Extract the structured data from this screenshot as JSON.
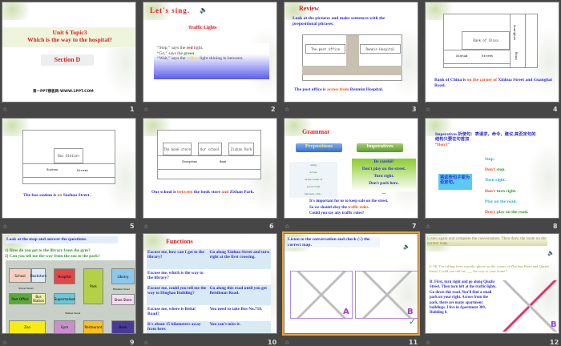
{
  "slides": [
    {
      "number": "1",
      "title1": "Unit 6 Topic3",
      "title2": "Which is the way to the hospital?",
      "section": "Section D",
      "footer": "第一PPT模板网-WWW.1PPT.COM"
    },
    {
      "number": "2",
      "heading": "Let's sing.",
      "song": "Traffic Lights",
      "l1a": "“Stop,” says the ",
      "l1b": "red",
      "l1c": " light.",
      "l2a": "“Go,” says the ",
      "l2b": "green",
      "l2c": ".",
      "l3a": "“Wait,” says the ",
      "l3b": "yellow",
      "l3c": " light shining in between."
    },
    {
      "number": "3",
      "heading": "Review",
      "instr": "Look at the pictures and make sentences with the prepositional phrases.",
      "box1": "The post office",
      "box2": "Renmin Hospital",
      "s1": "The post office is ",
      "s2": "across from",
      "s3": " Renmin Hospital."
    },
    {
      "number": "4",
      "bank": "Bank of China",
      "street1": "Xinhua",
      "street2": "Street",
      "road1": "Guanghai",
      "road2": "Road",
      "s1": "Bank of China is ",
      "s2": "on the corner of",
      "s3": " Xinhua Street and Guanghai Road."
    },
    {
      "number": "5",
      "station": "Bus Station",
      "street1": "Suzhou",
      "street2": "Street",
      "s1": "The bus station is ",
      "s2": "on",
      "s3": " Suzhou Street."
    },
    {
      "number": "6",
      "b1": "The book store",
      "b2": "Our school",
      "b3": "Zishan Park",
      "road1": "Zhongshan",
      "road2": "Road",
      "s1": "Our school is ",
      "s2": "between",
      "s3": " the book store ",
      "s4": "and",
      "s5": " Zishan Park."
    },
    {
      "number": "7",
      "heading": "Grammar",
      "btn1": "Prepositions",
      "btn2": "Imperatives",
      "preps": [
        "along",
        "across",
        "on the corner of",
        "across from",
        "between...and..."
      ],
      "imps": [
        "Be careful!",
        "Don't play on the street.",
        "Turn right.",
        "Don't park here."
      ],
      "dots": "...",
      "p1": "It's important for us to keep safe on the street.",
      "p2a": "So we should obey the ",
      "p2b": "traffic rules",
      "p2c": ".",
      "p3": "Could you say any traffic rules?"
    },
    {
      "number": "8",
      "intro": "Imperatives 祈使句：表请求，命令，建议;其否定句的结构只要在句首加",
      "dont": "“Don't”",
      "task": "将这些句子变为否定句。",
      "lines": [
        {
          "a": "",
          "b": "Stop."
        },
        {
          "a": "Don't ",
          "b": "stop."
        },
        {
          "a": "",
          "b": "Turn right."
        },
        {
          "a": "Don't ",
          "b": "turn right."
        },
        {
          "a": "",
          "b": "Play on the road."
        },
        {
          "a": "Don't ",
          "b": "play on the road."
        }
      ]
    },
    {
      "number": "9",
      "instr": "Look at the map and answer the questions.",
      "q1": "1) How do you get to the library from the gym?",
      "q2": "2) Can you tell me the way from the zoo to the park?",
      "places": [
        "School",
        "Bookstore",
        "Hospital",
        "Park",
        "Library",
        "Post Office",
        "Bus Station",
        "Supermarket",
        "Shoe Store",
        "Zoo",
        "Gym",
        "Restaurant",
        "Bank"
      ],
      "streets": [
        "Xiaoxi Street",
        "Xinhua Street",
        "Hanmen Street"
      ]
    },
    {
      "number": "10",
      "heading": "Functions",
      "rows": [
        [
          "Excuse me, how can I get to the library?",
          "Go along Xinhua Street and turn right at the first crossing."
        ],
        [
          "Excuse me, which is the way to the library?",
          ""
        ],
        [
          "Excuse me, could you tell me the way to Dinghao Building?",
          "Go along this road until you get Beisihuan Road."
        ],
        [
          "Excuse me, where is Beitai Road?",
          "You need to take Bus No.718."
        ],
        [
          "It's about 15 kilometers away from here.",
          "You can't miss it."
        ]
      ]
    },
    {
      "number": "11",
      "instr": "Listen to the conversation and check (√) the correct map.",
      "mapA": "A",
      "mapB": "B"
    },
    {
      "number": "12",
      "instr": "Listen again and complete the conversation. Then draw the route on the correct map.",
      "a": "A: Hi! I'm calling from a public phone on the corner of Zhichun Road and Qiuzhi Street. Could you tell me ___ the way to your home?",
      "blanks": [
        "the",
        "way",
        "right",
        "along",
        "left",
        "Go",
        "Across from"
      ],
      "b": "B: First, turn right and go along Qiuzhi Street. Then turn left at the traffic lights. Go down this road. You'll find a small park on your right. Across from the park, there are many apartment buildings. I live in Apartment 309, Building 8.",
      "mapB": "B"
    }
  ]
}
